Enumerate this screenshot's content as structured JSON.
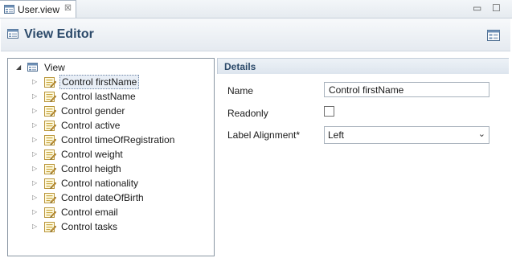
{
  "tab": {
    "label": "User.view",
    "close": "☒"
  },
  "window": {
    "minimize": "▭",
    "maximize": "☐"
  },
  "header": {
    "title": "View Editor"
  },
  "tree": {
    "root": {
      "label": "View",
      "expander": "◢"
    },
    "items": [
      {
        "label": "Control firstName",
        "selected": true
      },
      {
        "label": "Control lastName"
      },
      {
        "label": "Control gender"
      },
      {
        "label": "Control active"
      },
      {
        "label": "Control timeOfRegistration"
      },
      {
        "label": "Control weight"
      },
      {
        "label": "Control heigth"
      },
      {
        "label": "Control nationality"
      },
      {
        "label": "Control dateOfBirth"
      },
      {
        "label": "Control email"
      },
      {
        "label": "Control tasks"
      }
    ],
    "collapsed_expander": "▷"
  },
  "details": {
    "title": "Details",
    "name_label": "Name",
    "name_value": "Control firstName",
    "readonly_label": "Readonly",
    "readonly_checked": false,
    "alignment_label": "Label Alignment*",
    "alignment_value": "Left",
    "dropdown_arrow": "⌄"
  },
  "colors": {
    "title_blue": "#2c4a6a",
    "header_gradient_top": "#f7f9fb",
    "header_gradient_bottom": "#e5eaf0",
    "selection_bg": "#e8eef6"
  }
}
